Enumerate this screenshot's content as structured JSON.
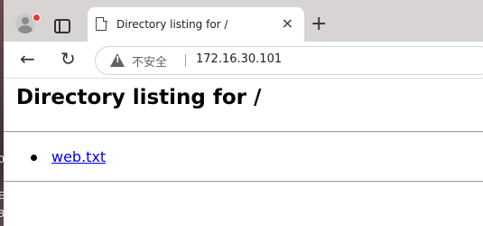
{
  "browser": {
    "tab_title": "Directory listing for /",
    "tab_close": "×",
    "new_tab": "+",
    "back_glyph": "←",
    "reload_glyph": "↻",
    "security_label": "不安全",
    "url": "172.16.30.101"
  },
  "page": {
    "heading": "Directory listing for /",
    "files": [
      "web.txt"
    ]
  },
  "colors": {
    "tabbar_bg": "#d7d4d3",
    "link": "#0000ee",
    "profile_badge": "#e53935"
  }
}
